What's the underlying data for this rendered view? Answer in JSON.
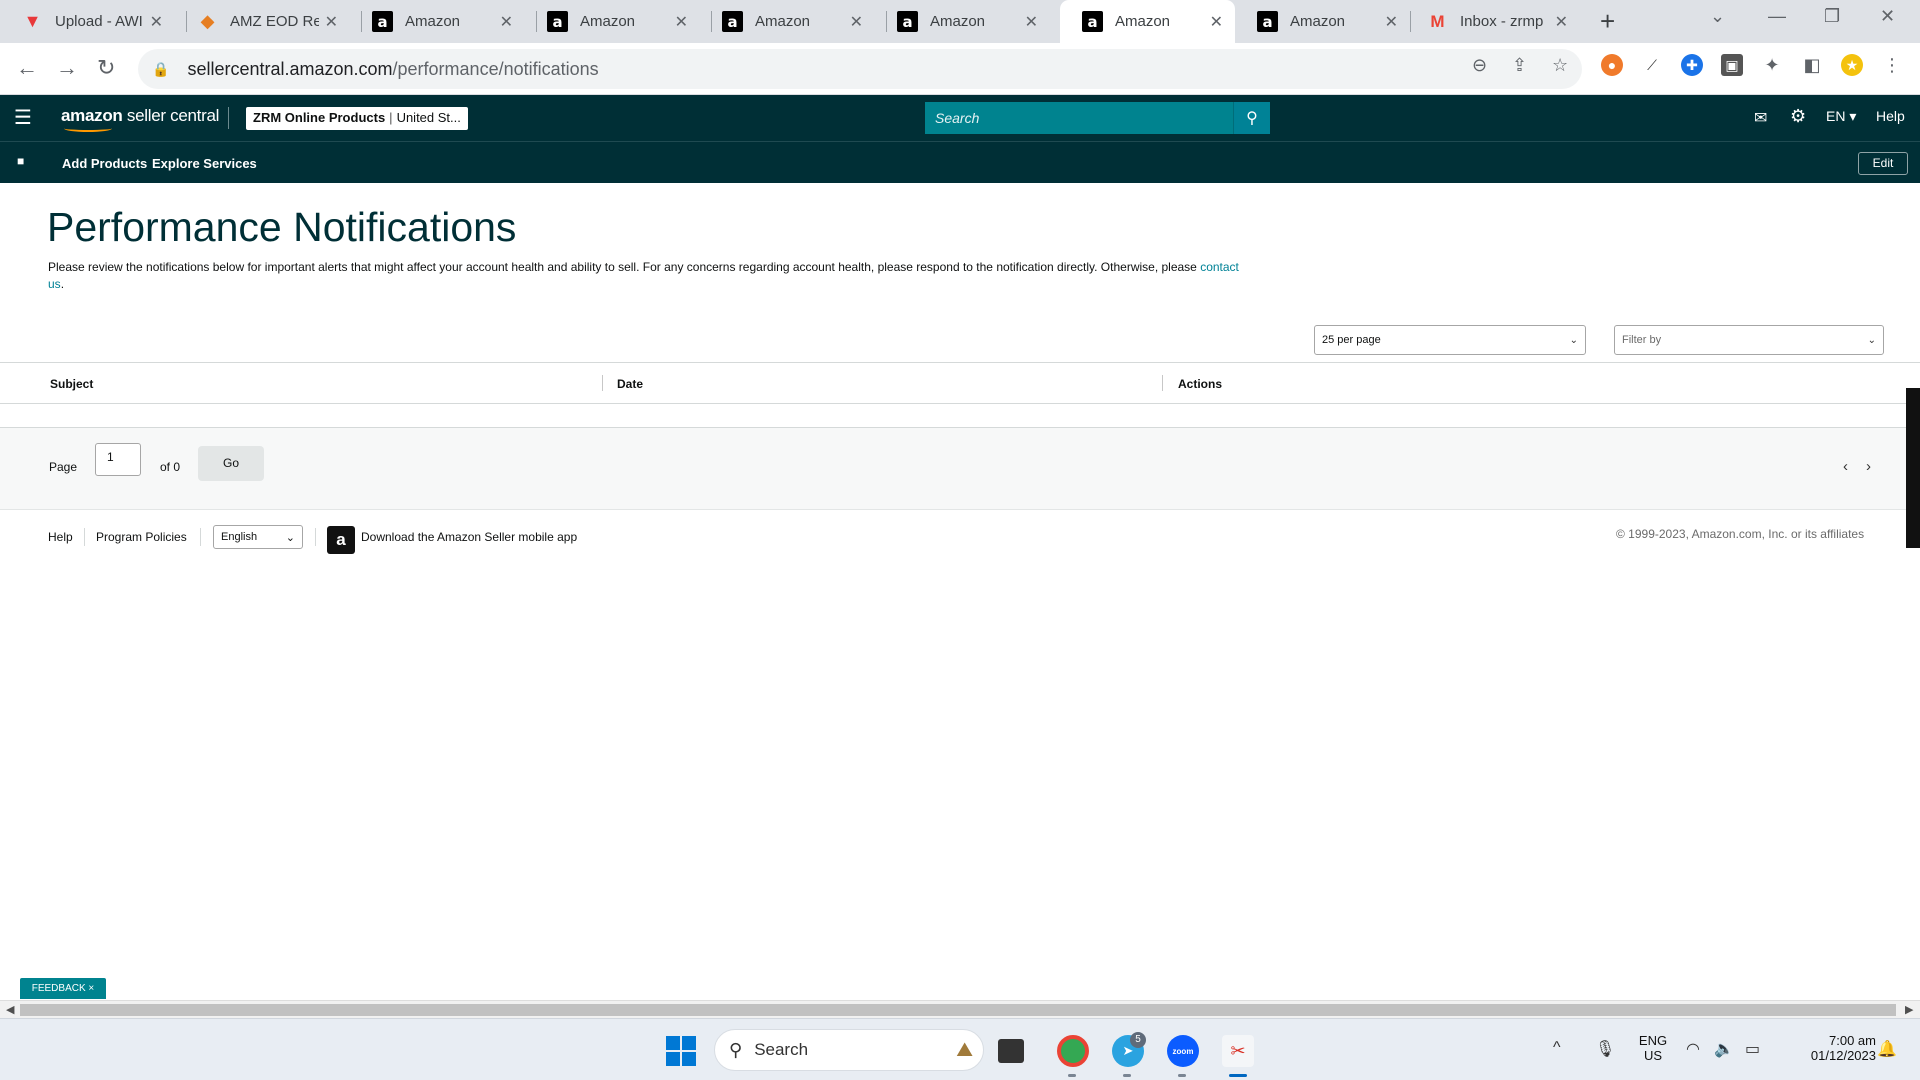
{
  "browser": {
    "tabs": [
      {
        "title": "Upload - AWI",
        "favicon": "vee-icon",
        "active": false
      },
      {
        "title": "AMZ EOD Rep",
        "favicon": "amz-eod-icon",
        "active": false
      },
      {
        "title": "Amazon",
        "favicon": "amazon-icon",
        "active": false
      },
      {
        "title": "Amazon",
        "favicon": "amazon-icon",
        "active": false
      },
      {
        "title": "Amazon",
        "favicon": "amazon-icon",
        "active": false
      },
      {
        "title": "Amazon",
        "favicon": "amazon-icon",
        "active": false
      },
      {
        "title": "Amazon",
        "favicon": "amazon-icon",
        "active": true
      },
      {
        "title": "Amazon",
        "favicon": "amazon-icon",
        "active": false
      },
      {
        "title": "Inbox - zrmp",
        "favicon": "gmail-icon",
        "active": false
      }
    ],
    "url_host": "sellercentral.amazon.com",
    "url_path": "/performance/notifications"
  },
  "header": {
    "brand_main": "amazon",
    "brand_rest": " seller central",
    "account_name": "ZRM Online Products",
    "account_market": "United St...",
    "search_placeholder": "Search",
    "language": "EN",
    "help": "Help"
  },
  "subnav": {
    "items": [
      "Add Products",
      "Explore Services"
    ],
    "edit": "Edit"
  },
  "page": {
    "title": "Performance Notifications",
    "intro_text": "Please review the notifications below for important alerts that might affect your account health and ability to sell. For any concerns regarding account health, please respond to the notification directly. Otherwise, please ",
    "intro_link": "contact us",
    "intro_end": ".",
    "per_page": "25 per page",
    "filter_placeholder": "Filter by"
  },
  "table": {
    "columns": [
      "Subject",
      "Date",
      "Actions"
    ]
  },
  "pager": {
    "page_label": "Page",
    "page_value": "1",
    "of_label": "of 0",
    "go": "Go"
  },
  "footer": {
    "help": "Help",
    "program_policies": "Program Policies",
    "language": "English",
    "app_text": "Download the Amazon Seller mobile app",
    "copyright": "© 1999-2023, Amazon.com, Inc. or its affiliates"
  },
  "feedback": "FEEDBACK ×",
  "taskbar": {
    "search": "Search",
    "telegram_badge": "5",
    "lang_line1": "ENG",
    "lang_line2": "US",
    "time": "7:00 am",
    "date": "01/12/2023"
  },
  "colors": {
    "header_bg": "#002f36",
    "search_bg": "#00838f",
    "link": "#008296",
    "title": "#002f36"
  }
}
